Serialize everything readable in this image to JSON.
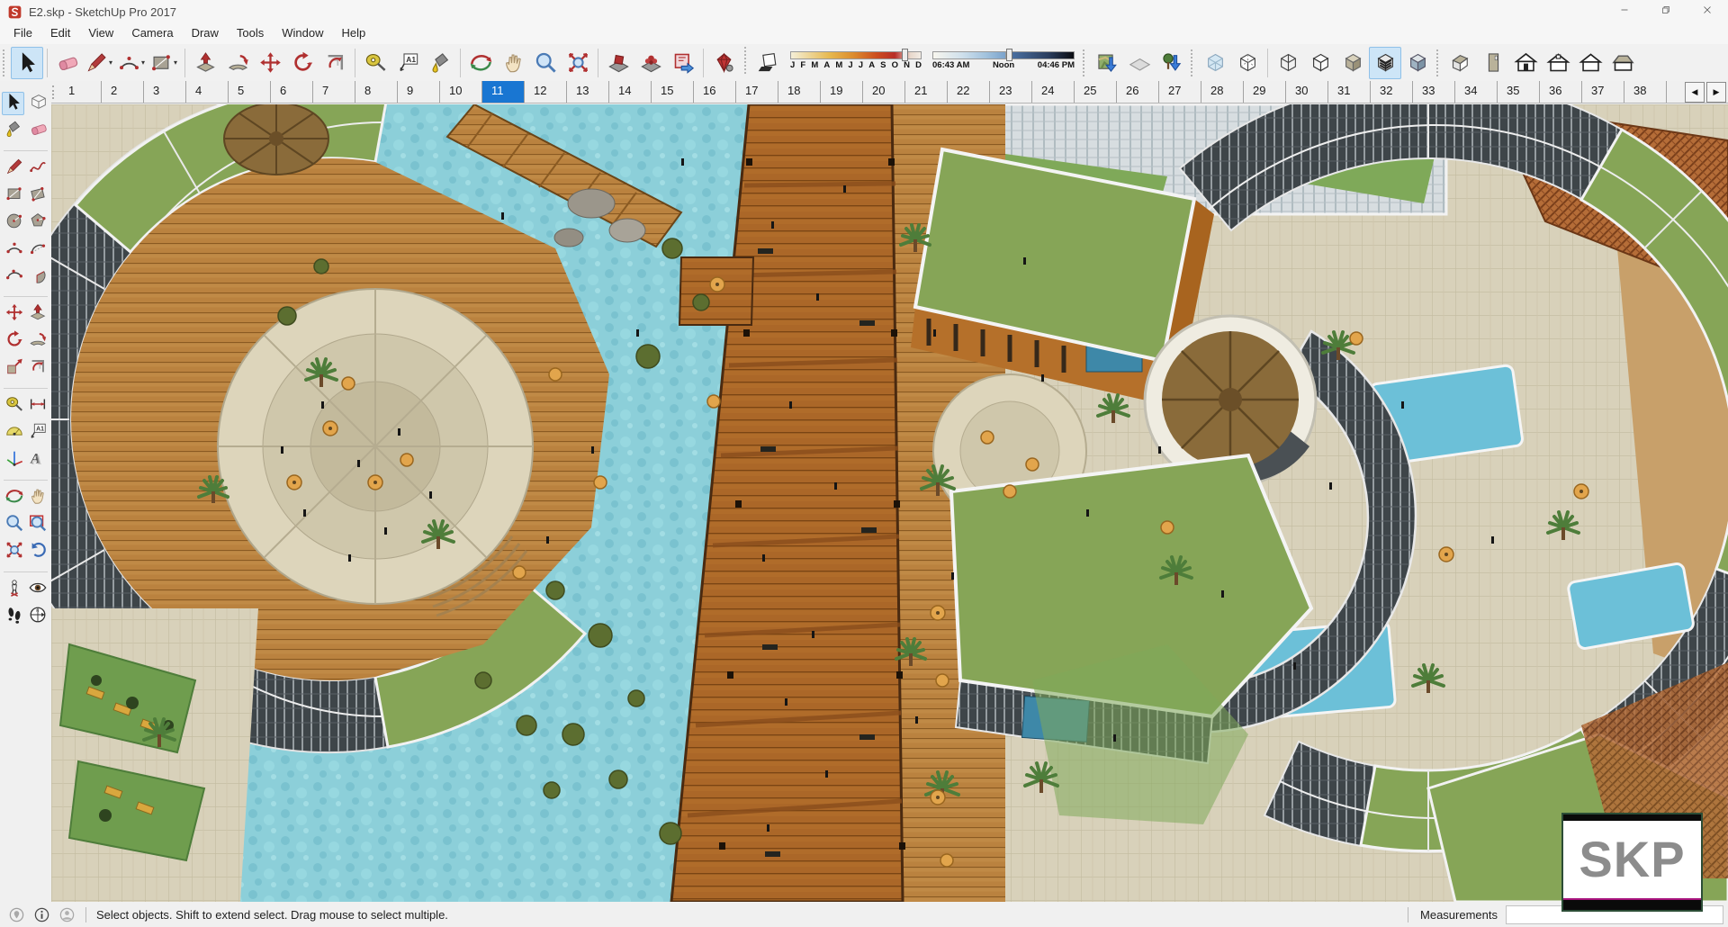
{
  "window": {
    "title": "E2.skp - SketchUp Pro 2017",
    "logo_icon": "sketchup-logo-icon",
    "controls": [
      {
        "name": "minimize",
        "icon": "minimize-icon"
      },
      {
        "name": "restore",
        "icon": "restore-icon"
      },
      {
        "name": "close",
        "icon": "close-icon"
      }
    ]
  },
  "menu_bar": {
    "items": [
      "File",
      "Edit",
      "View",
      "Camera",
      "Draw",
      "Tools",
      "Window",
      "Help"
    ]
  },
  "toolbar": {
    "left_groups": [
      {
        "lead": "grip",
        "items": [
          {
            "name": "select",
            "icon": "select-icon",
            "active": true
          }
        ]
      },
      {
        "lead": "sep",
        "items": [
          {
            "name": "eraser",
            "icon": "eraser-icon"
          },
          {
            "name": "line",
            "icon": "line-icon",
            "dropdown": true
          },
          {
            "name": "arc",
            "icon": "arc-icon",
            "dropdown": true
          },
          {
            "name": "rectangle",
            "icon": "rectangle-icon",
            "dropdown": true
          }
        ]
      },
      {
        "lead": "sep",
        "items": [
          {
            "name": "push-pull",
            "icon": "pushpull-icon"
          },
          {
            "name": "follow-me",
            "icon": "followme-icon"
          },
          {
            "name": "move",
            "icon": "move-icon"
          },
          {
            "name": "rotate",
            "icon": "rotate-icon"
          },
          {
            "name": "offset",
            "icon": "offset-icon"
          }
        ]
      },
      {
        "lead": "sep",
        "items": [
          {
            "name": "tape-measure",
            "icon": "tape-icon"
          },
          {
            "name": "text",
            "icon": "text-icon"
          },
          {
            "name": "paint-bucket",
            "icon": "paint-icon"
          }
        ]
      },
      {
        "lead": "sep",
        "items": [
          {
            "name": "orbit",
            "icon": "orbit-icon"
          },
          {
            "name": "pan",
            "icon": "pan-icon"
          },
          {
            "name": "zoom",
            "icon": "zoom-icon"
          },
          {
            "name": "zoom-extents",
            "icon": "zoom-extents-icon"
          }
        ]
      },
      {
        "lead": "sep",
        "items": [
          {
            "name": "plugin-box",
            "icon": "plugin-box-icon"
          },
          {
            "name": "plugin-flower",
            "icon": "plugin-flower-icon"
          },
          {
            "name": "plugin-export",
            "icon": "plugin-export-icon"
          }
        ]
      },
      {
        "lead": "sep",
        "items": [
          {
            "name": "plugin-gem",
            "icon": "gem-icon"
          }
        ]
      }
    ],
    "shadows": {
      "toggle_icon": "shadow-toggle-icon",
      "month_labels": [
        "J",
        "F",
        "M",
        "A",
        "M",
        "J",
        "J",
        "A",
        "S",
        "O",
        "N",
        "D"
      ],
      "date_thumb_pct": 85,
      "time_start": "06:43 AM",
      "time_mid": "Noon",
      "time_end": "04:46 PM",
      "time_thumb_pct": 52
    },
    "right_groups": [
      {
        "lead": "grip",
        "items": [
          {
            "name": "add-location",
            "icon": "add-location-icon"
          },
          {
            "name": "toggle-terrain",
            "icon": "toggle-terrain-icon"
          },
          {
            "name": "add-building",
            "icon": "add-building-icon"
          }
        ]
      },
      {
        "lead": "grip",
        "items": [
          {
            "name": "xray",
            "icon": "xray-icon"
          },
          {
            "name": "back-edges",
            "icon": "back-edges-icon"
          }
        ]
      },
      {
        "lead": "sep",
        "items": [
          {
            "name": "wireframe",
            "icon": "wireframe-icon"
          },
          {
            "name": "hidden-line",
            "icon": "hidden-line-icon"
          },
          {
            "name": "shaded",
            "icon": "shaded-icon"
          },
          {
            "name": "shaded-with-textures",
            "icon": "textured-icon",
            "active": true
          },
          {
            "name": "monochrome",
            "icon": "monochrome-icon"
          }
        ]
      },
      {
        "lead": "grip",
        "items": [
          {
            "name": "view-iso",
            "icon": "view-iso-icon"
          },
          {
            "name": "view-top",
            "icon": "view-top-icon"
          },
          {
            "name": "view-front",
            "icon": "view-front-icon"
          },
          {
            "name": "view-right",
            "icon": "view-right-icon"
          },
          {
            "name": "view-back",
            "icon": "view-back-icon"
          },
          {
            "name": "view-left",
            "icon": "view-left-icon"
          }
        ]
      }
    ]
  },
  "scene_tabs": {
    "labels": [
      "1",
      "2",
      "3",
      "4",
      "5",
      "6",
      "7",
      "8",
      "9",
      "10",
      "11",
      "12",
      "13",
      "14",
      "15",
      "16",
      "17",
      "18",
      "19",
      "20",
      "21",
      "22",
      "23",
      "24",
      "25",
      "26",
      "27",
      "28",
      "29",
      "30",
      "31",
      "32",
      "33",
      "34",
      "35",
      "36",
      "37",
      "38"
    ],
    "active": "11",
    "scroll_left": "◀",
    "scroll_right": "▶"
  },
  "tool_palette": {
    "active": "select-icon",
    "groups": [
      [
        [
          "select-icon",
          "make-component-icon"
        ],
        [
          "paint-icon",
          "eraser-icon"
        ]
      ],
      [
        [
          "line-icon",
          "freehand-icon"
        ],
        [
          "rectangle-icon",
          "rotated-rectangle-icon"
        ],
        [
          "circle-icon",
          "polygon-icon"
        ],
        [
          "arc-icon",
          "arc2-icon"
        ],
        [
          "arc3-icon",
          "pie-icon"
        ]
      ],
      [
        [
          "move-icon",
          "pushpull-icon"
        ],
        [
          "rotate-icon",
          "followme-icon"
        ],
        [
          "scale-icon",
          "offset-icon"
        ]
      ],
      [
        [
          "tape-icon",
          "dimension-icon"
        ],
        [
          "protractor-icon",
          "text-icon"
        ],
        [
          "axes-icon",
          "text3d-icon"
        ]
      ],
      [
        [
          "orbit-icon",
          "pan-icon"
        ],
        [
          "zoom-icon",
          "zoom-window-icon"
        ],
        [
          "zoom-extents-icon",
          "previous-icon"
        ]
      ],
      [
        [
          "position-camera-icon",
          "look-around-icon"
        ],
        [
          "walk-icon",
          "section-plane-icon"
        ]
      ]
    ]
  },
  "status_bar": {
    "icons": [
      "geolocation-icon",
      "info-icon",
      "credits-icon"
    ],
    "hint": "Select objects. Shift to extend select. Drag mouse to select multiple.",
    "measurements_label": "Measurements",
    "measurements_value": ""
  },
  "viewport": {
    "billboard_text": "SKP"
  },
  "colors": {
    "active_tab_blue": "#1976d2",
    "toolbar_highlight": "#cde5f7",
    "water": "#8ccfd9",
    "boardwalk_wood": "#b06c2a",
    "deck_wood": "#c08a46",
    "roof_green": "#86a557",
    "lawn_green": "#7fa959",
    "thatch_brown": "#8a6b3a",
    "plaza_beige": "#d8d1ba",
    "glass_dark": "#3e4549"
  }
}
